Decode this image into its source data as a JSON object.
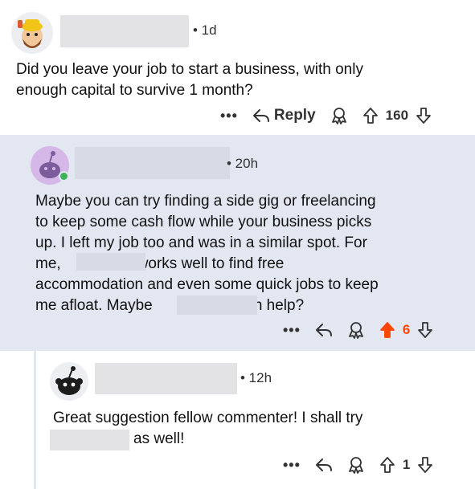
{
  "comments": [
    {
      "time": "• 1d",
      "lines": [
        "Did you leave your job to start a business, with only",
        "enough capital to survive 1 month?"
      ],
      "reply_label": "Reply",
      "more": "•••",
      "votes": "160"
    },
    {
      "time": "• 20h",
      "lines": [
        "Maybe you can try finding a side gig or freelancing",
        "to keep some cash flow while your business picks",
        "up. I left my job too and was in a similar spot. For",
        "me,",
        "works well to find free",
        "accommodation and even some quick jobs to keep",
        "me afloat. Maybe",
        "can help?"
      ],
      "more": "•••",
      "votes": "6",
      "upvoted": true
    },
    {
      "time": "• 12h",
      "lines": [
        "Great suggestion fellow commenter! I shall try",
        "as well!"
      ],
      "more": "•••",
      "votes": "1"
    }
  ],
  "colors": {
    "thread_bg": "#e2e7f2",
    "upvote_active": "#ff4500",
    "online": "#3cb45a"
  }
}
